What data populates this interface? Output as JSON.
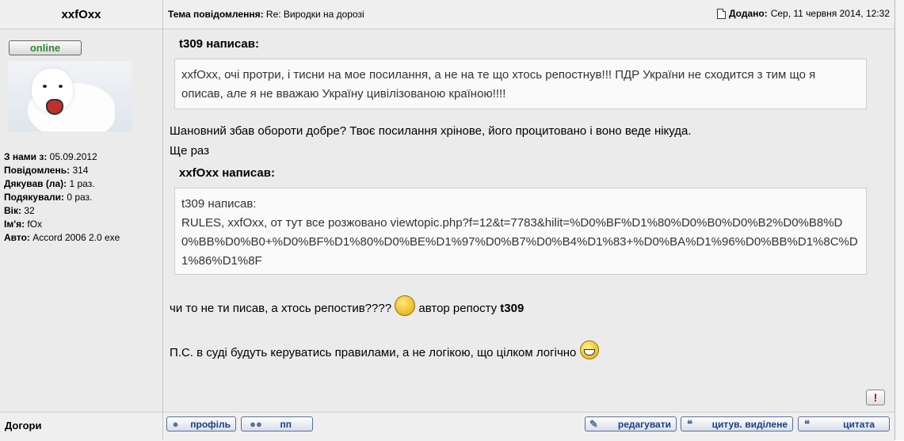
{
  "author": {
    "name": "xxfOxx",
    "status": "online",
    "stats": [
      {
        "label": "З нами з:",
        "value": "05.09.2012"
      },
      {
        "label": "Повідомлень:",
        "value": "314"
      },
      {
        "label": "Дякував (ла):",
        "value": "1 раз."
      },
      {
        "label": "Подякували:",
        "value": "0 раз."
      },
      {
        "label": "Вік:",
        "value": "32"
      },
      {
        "label": "Ім'я:",
        "value": "fOx"
      },
      {
        "label": "Авто:",
        "value": "Accord 2006 2.0 exe"
      }
    ]
  },
  "header": {
    "subject_label": "Тема повідомлення:",
    "subject": "Re: Виродки на дорозі",
    "posted_label": "Додано:",
    "posted": "Сер, 11 червня 2014, 12:32"
  },
  "post": {
    "quote1": {
      "author": "t309 написав:",
      "text": "xxfOxx, очі протри, і тисни на мое посилання, а не на те що хтось репостнув!!! ПДР України не сходится з тим що я описав, але я не вважаю Україну цивілізованою країною!!!!"
    },
    "line1": "Шановний збав обороти добре? Твоє посилання хрінове, його процитовано і воно веде нікуда.",
    "line2": "Ще раз",
    "quote2": {
      "author": "xxfOxx написав:",
      "inner_author": "t309 написав:",
      "text": "RULES, xxfOxx, от тут все розжовано viewtopic.php?f=12&t=7783&hilit=%D0%BF%D1%80%D0%B0%D0%B2%D0%B8%D0%BB%D0%B0+%D0%BF%D1%80%D0%BE%D1%97%D0%B7%D0%B4%D1%83+%D0%BA%D1%96%D0%BB%D1%8C%D1%86%D1%8F"
    },
    "line3_a": "чи то не ти писав, а хтось репостив????",
    "line3_b": "автор репосту",
    "line3_c": "t309",
    "line4": "П.С. в суді будуть керуватись правилами, а не логікою, що цілком логічно"
  },
  "footer": {
    "location": "Догори",
    "report_label": "!",
    "buttons": {
      "profile": "профіль",
      "pm": "пп",
      "edit": "редагувати",
      "quote_selected": "цитув. виділене",
      "quote": "цитата"
    }
  }
}
